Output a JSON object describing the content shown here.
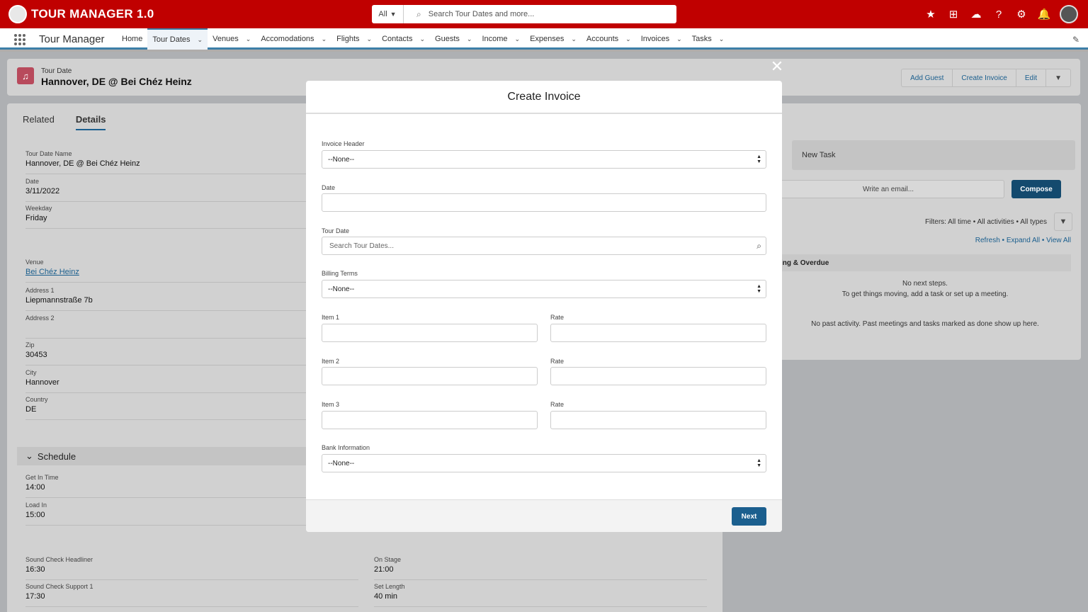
{
  "app": {
    "title": "TOUR MANAGER 1.0",
    "name": "Tour Manager"
  },
  "search": {
    "scope": "All",
    "placeholder": "Search Tour Dates and more..."
  },
  "nav": [
    "Home",
    "Tour Dates",
    "Venues",
    "Accomodations",
    "Flights",
    "Contacts",
    "Guests",
    "Income",
    "Expenses",
    "Accounts",
    "Invoices",
    "Tasks"
  ],
  "record": {
    "type": "Tour Date",
    "title": "Hannover, DE @ Bei Chéz Heinz",
    "buttons": [
      "Add Guest",
      "Create Invoice",
      "Edit"
    ]
  },
  "tabs": [
    "Related",
    "Details"
  ],
  "fields": {
    "tour_date_name": {
      "label": "Tour Date Name",
      "value": "Hannover, DE @ Bei Chéz Heinz"
    },
    "date": {
      "label": "Date",
      "value": "3/11/2022"
    },
    "weekday": {
      "label": "Weekday",
      "value": "Friday"
    },
    "venue": {
      "label": "Venue",
      "value": "Bei Chéz Heinz"
    },
    "address1": {
      "label": "Address 1",
      "value": "Liepmannstraße 7b"
    },
    "address2": {
      "label": "Address 2",
      "value": ""
    },
    "zip": {
      "label": "Zip",
      "value": "30453"
    },
    "city": {
      "label": "City",
      "value": "Hannover"
    },
    "country": {
      "label": "Country",
      "value": "DE"
    }
  },
  "schedule": {
    "title": "Schedule",
    "get_in": {
      "label": "Get In Time",
      "value": "14:00"
    },
    "load_in": {
      "label": "Load In",
      "value": "15:00"
    },
    "sc_headliner": {
      "label": "Sound Check Headliner",
      "value": "16:30"
    },
    "sc_support": {
      "label": "Sound Check Support 1",
      "value": "17:30"
    },
    "on_stage": {
      "label": "On Stage",
      "value": "21:00"
    },
    "set_length": {
      "label": "Set Length",
      "value": "40 min"
    }
  },
  "activity": {
    "new_task": "New Task",
    "email_placeholder": "Write an email...",
    "compose": "Compose",
    "filters": "Filters: All time • All activities • All types",
    "links": "Refresh • Expand All • View All",
    "overdue": "ing & Overdue",
    "no_next": "No next steps.",
    "no_next_sub": "To get things moving, add a task or set up a meeting.",
    "no_past": "No past activity. Past meetings and tasks marked as done show up here."
  },
  "modal": {
    "title": "Create Invoice",
    "invoice_header": {
      "label": "Invoice Header",
      "value": "--None--"
    },
    "date": {
      "label": "Date",
      "value": ""
    },
    "tour_date": {
      "label": "Tour Date",
      "placeholder": "Search Tour Dates..."
    },
    "billing_terms": {
      "label": "Billing Terms",
      "value": "--None--"
    },
    "item1": {
      "label": "Item 1"
    },
    "rate1": {
      "label": "Rate"
    },
    "item2": {
      "label": "Item 2"
    },
    "rate2": {
      "label": "Rate"
    },
    "item3": {
      "label": "Item 3"
    },
    "rate3": {
      "label": "Rate"
    },
    "bank": {
      "label": "Bank Information",
      "value": "--None--"
    },
    "next": "Next"
  }
}
